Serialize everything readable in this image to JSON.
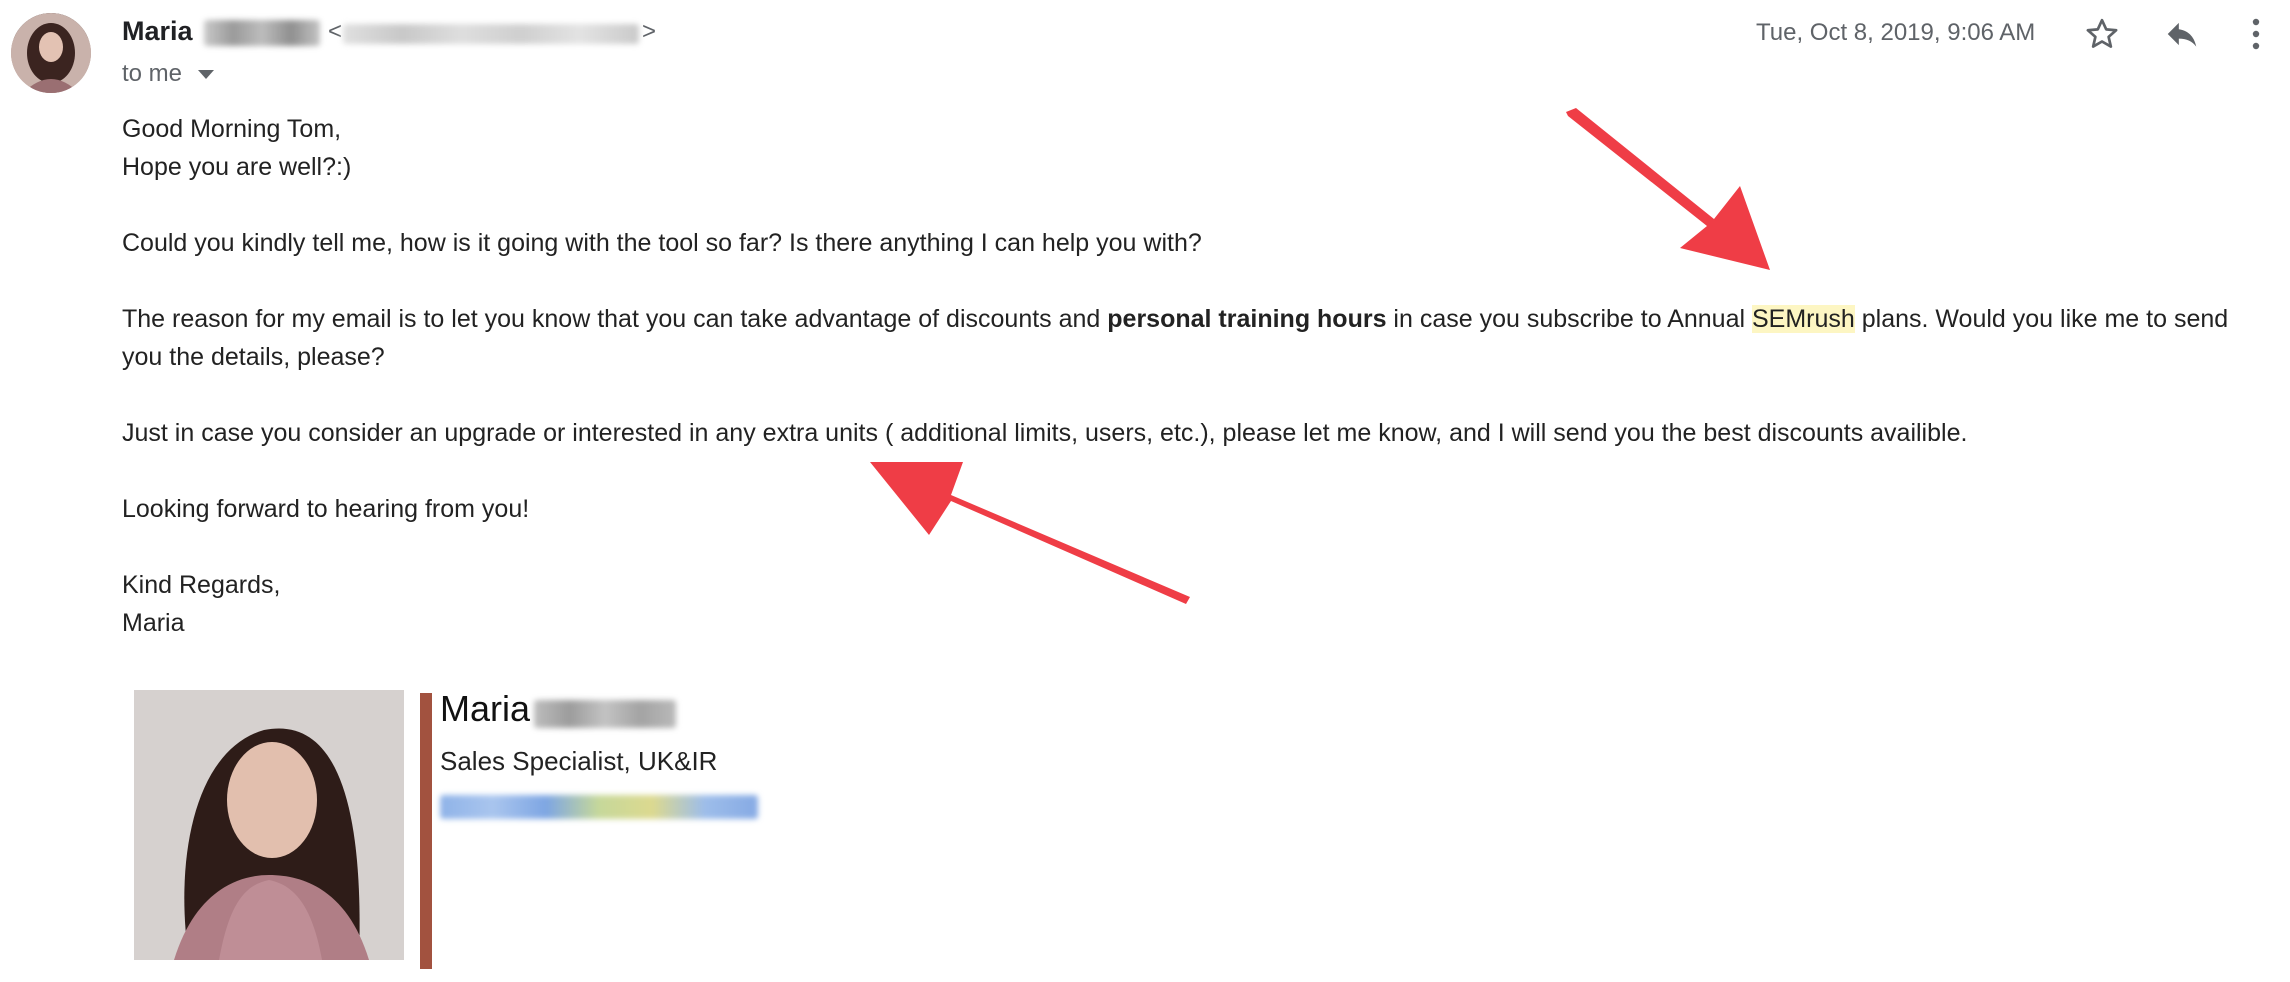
{
  "message": {
    "sender": {
      "name": "Maria",
      "email_open": "<",
      "email_close": ">"
    },
    "recipient": "to me",
    "date": "Tue, Oct 8, 2019, 9:06 AM",
    "icons": {
      "star": "star-icon",
      "reply": "reply-icon",
      "more": "more-vert-icon",
      "recipient_caret": "chevron-down-icon"
    },
    "body": {
      "greeting": "Good Morning Tom,",
      "wellbeing": "Hope you are well?:)",
      "question": "Could you kindly tell me, how is it going with the tool so far? Is there anything I can help you with?",
      "offer_part1": "The reason for my email is to let you know that you can take advantage of discounts and ",
      "offer_bold": "personal training hours",
      "offer_part2": " in case you subscribe to Annual ",
      "offer_highlight": "SEMrush",
      "offer_part3": " plans. Would you like me to send you the details, please?",
      "upgrade": "Just in case you consider an upgrade or interested in any extra units ( additional limits, users, etc.), please let me know, and I will send you the best discounts availible.",
      "closing": "Looking forward to hearing from you!",
      "regards": "Kind Regards,",
      "sign_name": "Maria"
    },
    "signature": {
      "name": "Maria",
      "title": "Sales Specialist, UK&IR",
      "accent_color": "#a2523f"
    }
  },
  "annotations": {
    "arrow_color": "#ef3d46"
  }
}
